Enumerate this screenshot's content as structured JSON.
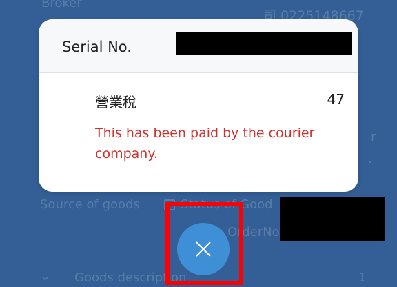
{
  "background": {
    "broker_label": "Broker",
    "phone": "司 0225148667",
    "source_label": "Source of goods",
    "status_label": "Status of Good",
    "order_label": "OrderNo",
    "goods_description_label": "Goods description",
    "goods_count": "1",
    "edge_text_1": "r",
    "edge_text_2": "."
  },
  "modal": {
    "serial_label": "Serial No.",
    "tax_label": "營業稅",
    "tax_value": "47",
    "notice": "This has been paid by the courier company."
  },
  "close_button": {
    "icon": "close-icon"
  },
  "colors": {
    "background": "#335f96",
    "notice": "#d0312d",
    "close_button": "#3f8fd6",
    "highlight": "#ff0000"
  }
}
